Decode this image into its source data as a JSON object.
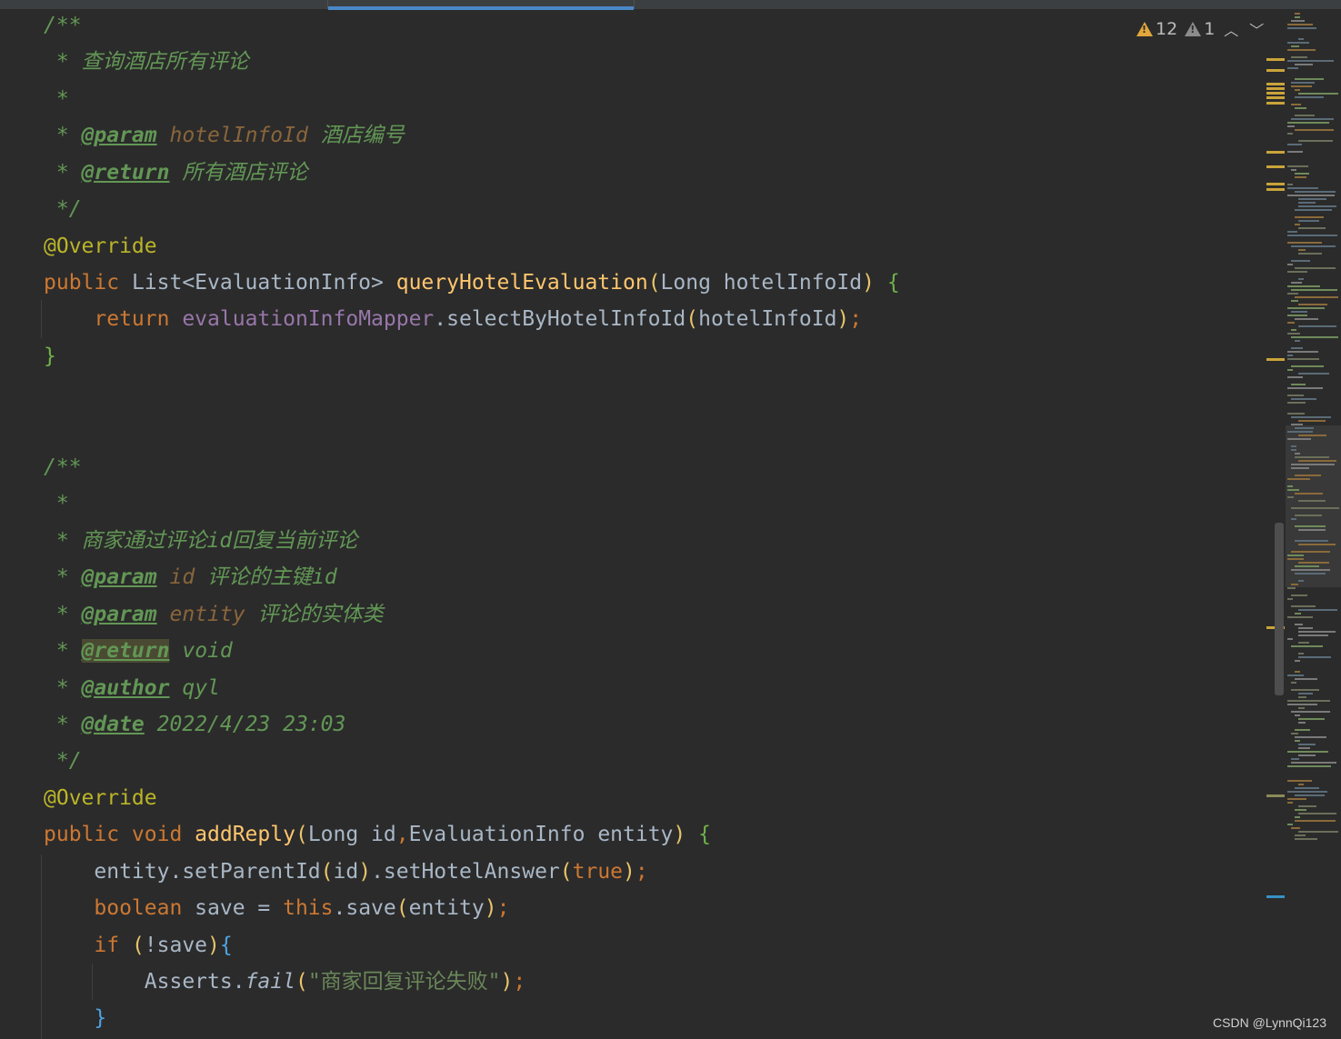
{
  "inspection": {
    "warning_count": "12",
    "weak_warning_count": "1"
  },
  "code": {
    "l1": "/**",
    "l2_star": " * ",
    "l2_text": "查询酒店所有评论",
    "l3": " *",
    "l4_star": " * ",
    "l4_tag": "@param",
    "l4_name": "hotelInfoId",
    "l4_desc": "酒店编号",
    "l5_star": " * ",
    "l5_tag": "@return",
    "l5_desc": "所有酒店评论",
    "l6": " */",
    "l7": "@Override",
    "l8_kw": "public ",
    "l8_type": "List<EvaluationInfo> ",
    "l8_fn": "queryHotelEvaluation",
    "l8_p1": "(",
    "l8_args": "Long hotelInfoId",
    "l8_p2": ")",
    "l8_sp": " ",
    "l8_brace": "{",
    "l9_kw": "    return ",
    "l9_field": "evaluationInfoMapper",
    "l9_call": ".selectByHotelInfoId",
    "l9_p1": "(",
    "l9_arg": "hotelInfoId",
    "l9_p2": ")",
    "l9_semi": ";",
    "l10": "}",
    "l11": "/**",
    "l12": " *",
    "l13_star": " * ",
    "l13_text": "商家通过评论id回复当前评论",
    "l14_star": " * ",
    "l14_tag": "@param",
    "l14_name": "id",
    "l14_desc": "评论的主键id",
    "l15_star": " * ",
    "l15_tag": "@param",
    "l15_name": "entity",
    "l15_desc": "评论的实体类",
    "l16_star": " * ",
    "l16_tag": "@return",
    "l16_desc": "void",
    "l17_star": " * ",
    "l17_tag": "@author",
    "l17_desc": "qyl",
    "l18_star": " * ",
    "l18_tag": "@date",
    "l18_desc": "2022/4/23 23:03",
    "l19": " */",
    "l20": "@Override",
    "l21_kw": "public void ",
    "l21_fn": "addReply",
    "l21_p1": "(",
    "l21_a1": "Long id",
    "l21_comma": ",",
    "l21_a2": "EvaluationInfo entity",
    "l21_p2": ")",
    "l21_sp": " ",
    "l21_brace": "{",
    "l22_a": "    entity.setParentId",
    "l22_p1": "(",
    "l22_b": "id",
    "l22_p2": ")",
    "l22_c": ".setHotelAnswer",
    "l22_p3": "(",
    "l22_kw": "true",
    "l22_p4": ")",
    "l22_semi": ";",
    "l23_kw": "    boolean ",
    "l23_a": "save = ",
    "l23_this": "this",
    "l23_b": ".save",
    "l23_p1": "(",
    "l23_c": "entity",
    "l23_p2": ")",
    "l23_semi": ";",
    "l24_kw": "    if ",
    "l24_p1": "(",
    "l24_a": "!save",
    "l24_p2": ")",
    "l24_brace": "{",
    "l25_a": "        Asserts.",
    "l25_fn": "fail",
    "l25_p1": "(",
    "l25_str": "\"商家回复评论失败\"",
    "l25_p2": ")",
    "l25_semi": ";",
    "l26": "    }"
  },
  "colors": {
    "background": "#2b2b2b",
    "keyword": "#cc7832",
    "doc_comment": "#629755",
    "method": "#ffc66d",
    "field": "#9876aa",
    "annotation": "#bbb529",
    "string": "#6a8759",
    "warning": "#e2a63b"
  },
  "watermark": "CSDN @LynnQi123"
}
